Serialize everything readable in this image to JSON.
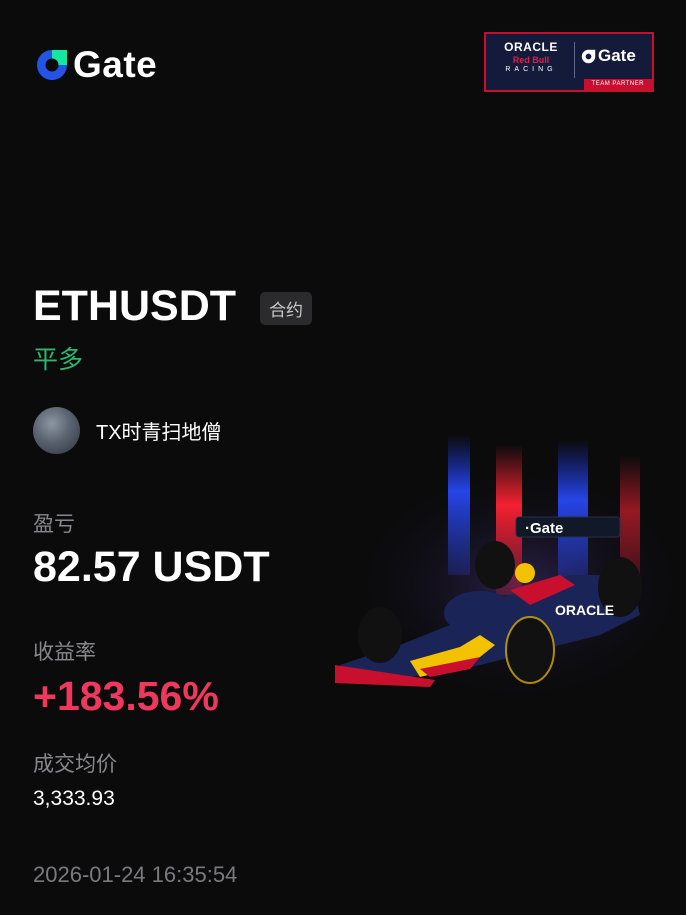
{
  "brand": {
    "name": "Gate",
    "logo_icon": "gate-logo-icon"
  },
  "partner": {
    "line1": "ORACLE",
    "line2": "Red Bull",
    "line3": "RACING",
    "gate": "Gate",
    "tag": "TEAM PARTNER"
  },
  "trade": {
    "pair": "ETHUSDT",
    "type_badge": "合约",
    "side": "平多"
  },
  "user": {
    "name": "TX时青扫地僧"
  },
  "pnl": {
    "label": "盈亏",
    "value": "82.57 USDT"
  },
  "roi": {
    "label": "收益率",
    "value": "+183.56%"
  },
  "avg_price": {
    "label": "成交均价",
    "value": "3,333.93"
  },
  "timestamp": "2026-01-24 16:35:54",
  "colors": {
    "positive": "#2fb56f",
    "roi": "#f0385e",
    "gate_blue": "#2354e6",
    "gate_green": "#17e6a1"
  }
}
